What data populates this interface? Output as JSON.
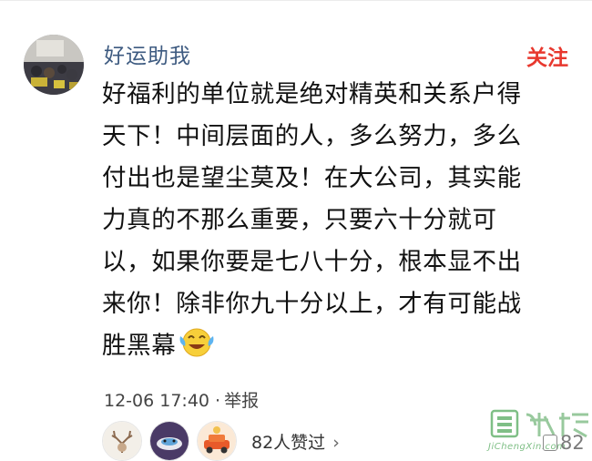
{
  "comment": {
    "username": "好运助我",
    "follow_label": "关注",
    "lines": [
      "好福利的单位就是绝对精英和关系户得",
      "天下！中间层面的人，多么努力，多么",
      "付出也是望尘莫及！在大公司，其实能",
      "力真的不那么重要，只要六十分就可",
      "以，如果你要是七八十分，根本显不出",
      "来你！除非你九十分以上，才有可能战",
      "胜黑幕"
    ],
    "emoji": "laughing-crying-emoji",
    "timestamp": "12-06 17:40",
    "separator": "·",
    "report_label": "举报",
    "likes_text": "82人赞过",
    "likes_chevron": "›",
    "like_count_partial": "82",
    "watermark_text": "JiChengXin.com"
  },
  "colors": {
    "username": "#3d5a80",
    "follow": "#e8382e",
    "text": "#111111",
    "meta": "#444444"
  }
}
